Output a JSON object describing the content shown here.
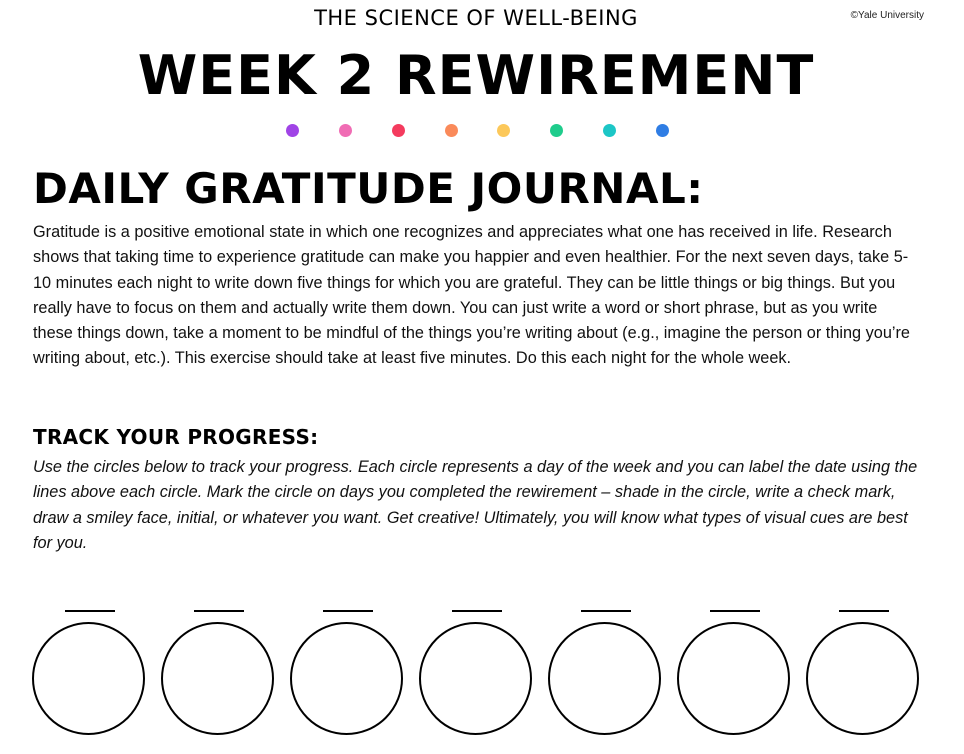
{
  "header": {
    "copyright": "©Yale University",
    "supertitle": "THE SCIENCE OF WELL-BEING",
    "title": "WEEK 2 REWIREMENT"
  },
  "decor_dots": [
    {
      "color": "#a044e6"
    },
    {
      "color": "#f06cb4"
    },
    {
      "color": "#f43b5e"
    },
    {
      "color": "#fa8a5a"
    },
    {
      "color": "#fcc85a"
    },
    {
      "color": "#1fcc8c"
    },
    {
      "color": "#1cc6c6"
    },
    {
      "color": "#2f7de4"
    }
  ],
  "journal": {
    "heading": "DAILY GRATITUDE JOURNAL:",
    "body": "Gratitude is a positive emotional state in which one recognizes and appreciates what one has received in life. Research shows that taking time to experience gratitude can make you happier and even healthier. For the next seven days, take 5-10 minutes each night to write down five things for which you are grateful. They can be little things or big things. But you really have to focus on them and actually write them down. You can just write a word or short phrase, but as you write these things down, take a moment to be mindful of the things you’re writing about (e.g., imagine the person or thing you’re writing about, etc.). This exercise should take at least five minutes. Do this each night for the whole week."
  },
  "progress": {
    "heading": "TRACK YOUR PROGRESS:",
    "instructions": "Use the circles below to track your progress. Each circle represents a day of the week and you can label the date using the lines above each circle. Mark the circle on days you completed the rewirement – shade in the circle, write a check mark, draw a smiley face, initial, or whatever you want. Get creative! Ultimately, you will know what types of visual cues are best for you.",
    "days": [
      {
        "date": ""
      },
      {
        "date": ""
      },
      {
        "date": ""
      },
      {
        "date": ""
      },
      {
        "date": ""
      },
      {
        "date": ""
      },
      {
        "date": ""
      }
    ]
  }
}
